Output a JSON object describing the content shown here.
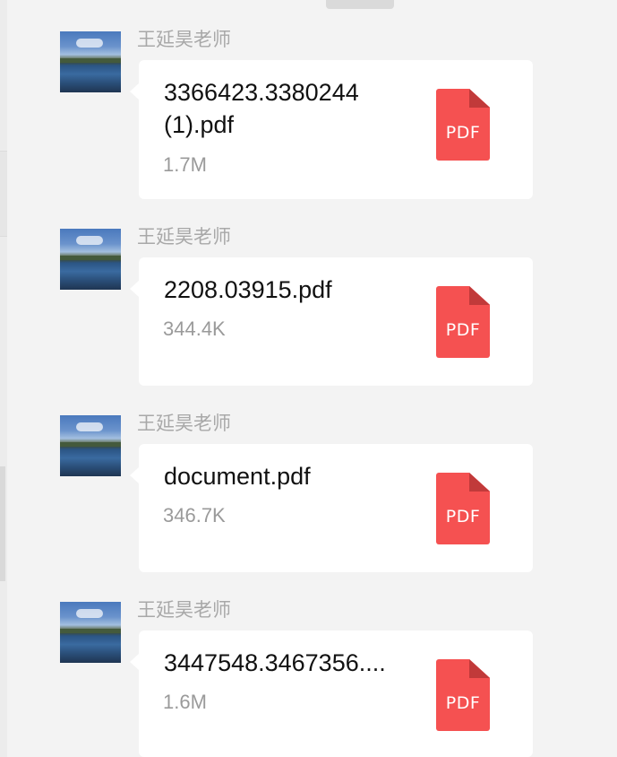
{
  "messages": [
    {
      "sender": "王延昊老师",
      "file_name": "3366423.3380244 (1).pdf",
      "file_size": "1.7M",
      "file_type_label": "PDF"
    },
    {
      "sender": "王延昊老师",
      "file_name": "2208.03915.pdf",
      "file_size": "344.4K",
      "file_type_label": "PDF"
    },
    {
      "sender": "王延昊老师",
      "file_name": "document.pdf",
      "file_size": "346.7K",
      "file_type_label": "PDF"
    },
    {
      "sender": "王延昊老师",
      "file_name": "3447548.3467356....",
      "file_size": "1.6M",
      "file_type_label": "PDF"
    }
  ],
  "colors": {
    "background": "#f3f3f3",
    "bubble": "#ffffff",
    "pdf_icon": "#f55151",
    "sender_text": "#a8a8a8",
    "size_text": "#9a9a9a"
  },
  "icons": {
    "file_icon": "pdf-file-icon",
    "avatar": "lake-landscape-avatar"
  }
}
